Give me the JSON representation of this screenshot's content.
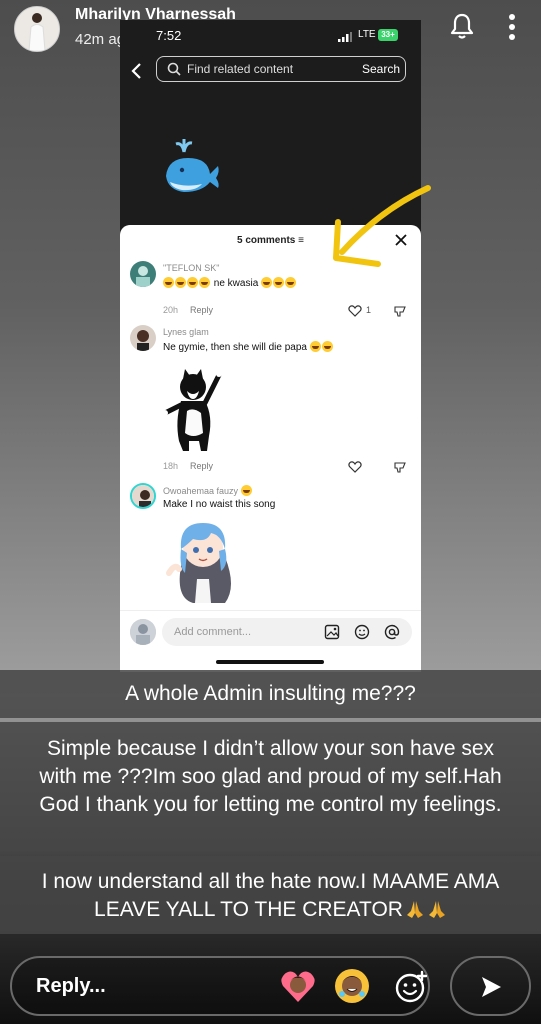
{
  "story": {
    "username": "Mharilyn Vharnessah",
    "posted_ago": "42m ago"
  },
  "phone": {
    "clock": "7:52",
    "network": "LTE",
    "battery": "33+",
    "search_placeholder": "Find related content",
    "search_button": "Search"
  },
  "comments_sheet": {
    "title": "5 comments",
    "comments": [
      {
        "user": "\"TEFLON SK\"",
        "text": "ne kwasia",
        "time": "20h",
        "reply": "Reply",
        "likes": "1"
      },
      {
        "user": "Lynes glam",
        "text": "Ne gymie, then she will die papa",
        "time": "18h",
        "reply": "Reply",
        "likes": ""
      },
      {
        "user": "Owoahemaa fauzy",
        "text": "Make I no waist this song",
        "time": "",
        "reply": "",
        "likes": ""
      }
    ],
    "add_comment_placeholder": "Add comment..."
  },
  "captions": [
    "A whole Admin insulting me???",
    "Simple because I didn’t allow your son have sex with me ???Im soo glad and proud of my self.Hah God I thank you for letting me control my feelings.",
    "I now understand all the hate now.I MAAME AMA LEAVE YALL TO THE CREATOR"
  ],
  "reply_bar": {
    "placeholder": "Reply..."
  },
  "colors": {
    "arrow": "#f1c40f",
    "battery": "#3bd36b"
  }
}
